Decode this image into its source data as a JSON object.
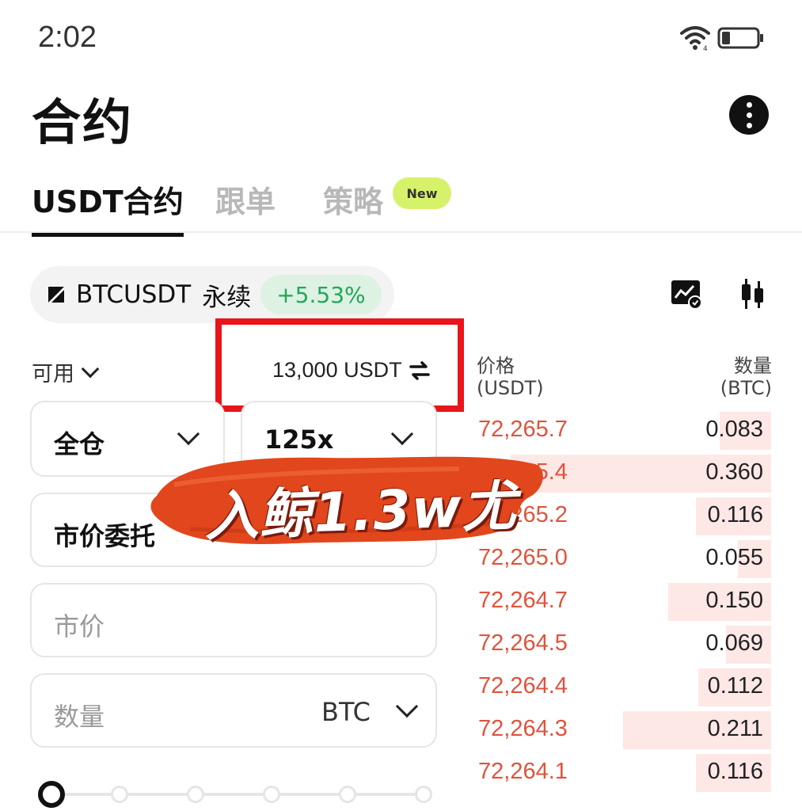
{
  "status_bar": {
    "time": "2:02"
  },
  "header": {
    "title": "合约"
  },
  "tabs": [
    {
      "label": "USDT合约",
      "active": true
    },
    {
      "label": "跟单",
      "active": false
    },
    {
      "label": "策略",
      "active": false
    }
  ],
  "tab_badge": "New",
  "pair": {
    "name": "BTCUSDT",
    "type": "永续",
    "change": "+5.53%"
  },
  "available": {
    "label": "可用",
    "value": "13,000 USDT"
  },
  "form": {
    "margin_mode": "全仓",
    "leverage": "125x",
    "order_type": "市价委托",
    "price_placeholder": "市价",
    "quantity_placeholder": "数量",
    "quantity_unit": "BTC",
    "slider_value_percent": 0
  },
  "orderbook": {
    "price_header": "价格",
    "price_unit": "(USDT)",
    "qty_header": "数量",
    "qty_unit": "(BTC)",
    "asks": [
      {
        "price": "72,265.7",
        "qty": "0.083",
        "depth": 0.17
      },
      {
        "price": "72,265.4",
        "qty": "0.360",
        "depth": 0.86
      },
      {
        "price": "72,265.2",
        "qty": "0.116",
        "depth": 0.25
      },
      {
        "price": "72,265.0",
        "qty": "0.055",
        "depth": 0.11
      },
      {
        "price": "72,264.7",
        "qty": "0.150",
        "depth": 0.34
      },
      {
        "price": "72,264.5",
        "qty": "0.069",
        "depth": 0.15
      },
      {
        "price": "72,264.4",
        "qty": "0.112",
        "depth": 0.24
      },
      {
        "price": "72,264.3",
        "qty": "0.211",
        "depth": 0.49
      },
      {
        "price": "72,264.1",
        "qty": "0.116",
        "depth": 0.25
      }
    ]
  },
  "overlay_caption": "入鲸1.3w尤",
  "colors": {
    "ask_red": "#e0533d",
    "up_green": "#22a75a",
    "highlight_red": "#e8151b",
    "stamp_orange": "#e2461c"
  }
}
